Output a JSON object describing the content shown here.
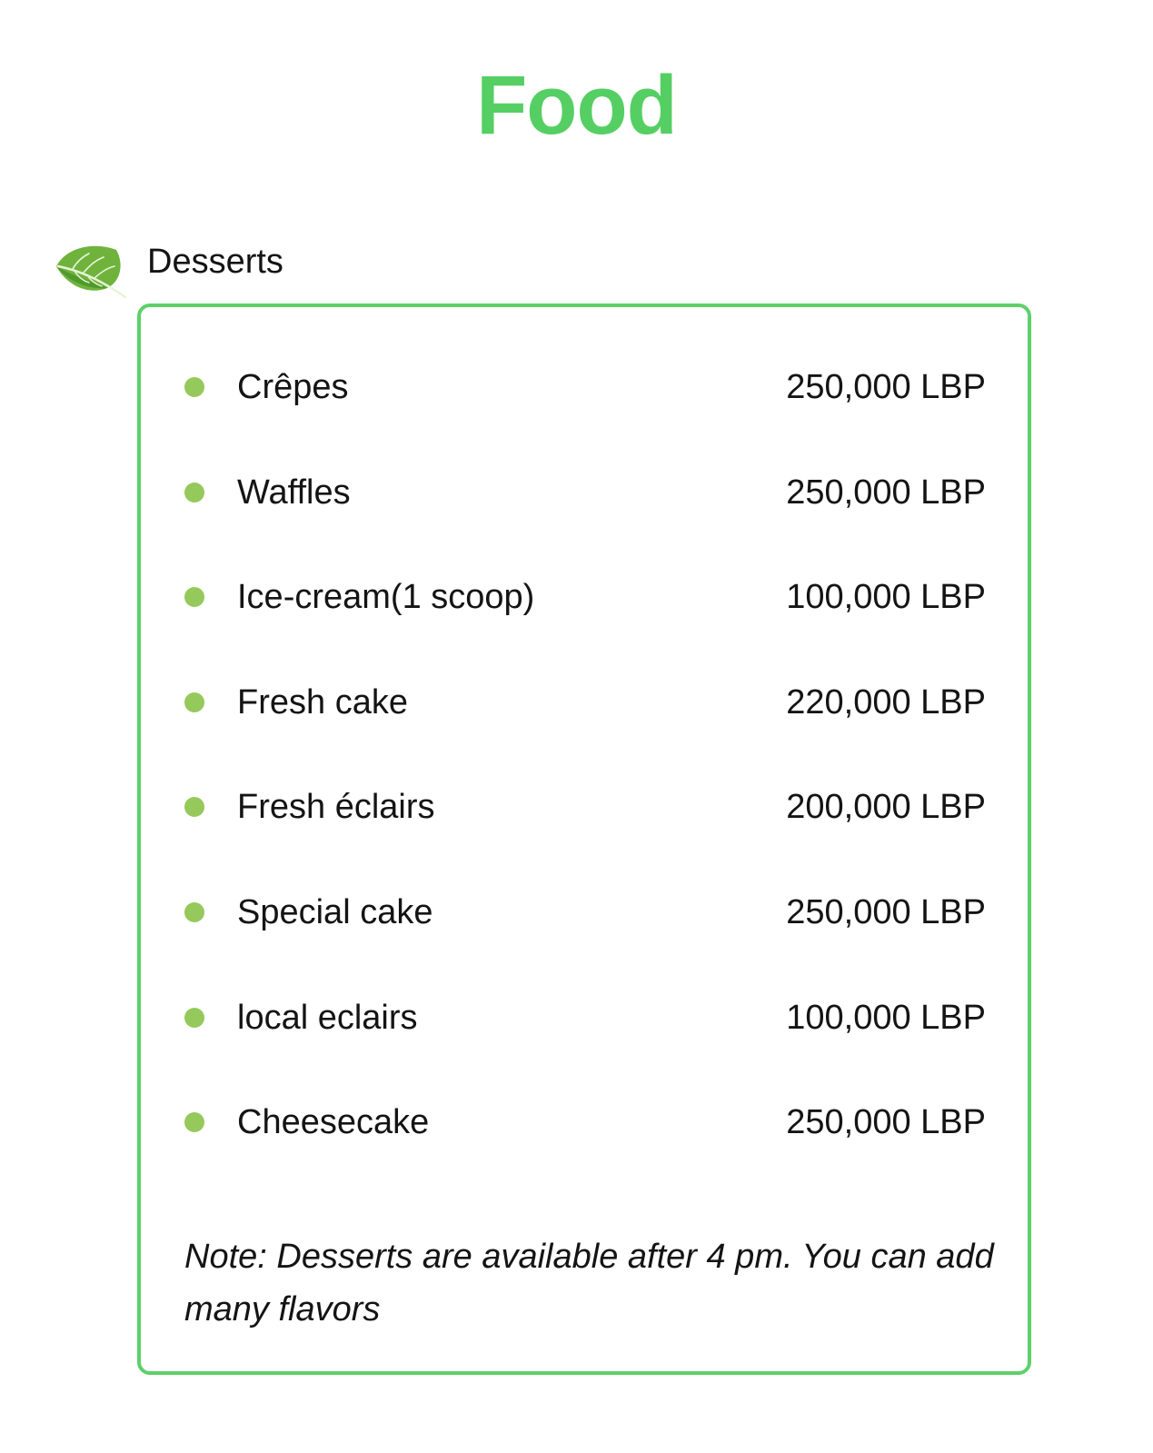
{
  "header": {
    "title": "Food",
    "title_color": "#55cf63"
  },
  "section": {
    "icon": "leaf-icon",
    "label": "Desserts",
    "border_color": "#5ed06a",
    "bullet_color": "#95c95b"
  },
  "items": [
    {
      "name": "Crêpes",
      "price": "250,000 LBP"
    },
    {
      "name": "Waffles",
      "price": "250,000 LBP"
    },
    {
      "name": "Ice-cream(1 scoop)",
      "price": "100,000 LBP"
    },
    {
      "name": "Fresh cake",
      "price": "220,000 LBP"
    },
    {
      "name": "Fresh éclairs",
      "price": "200,000 LBP"
    },
    {
      "name": "Special cake",
      "price": "250,000 LBP"
    },
    {
      "name": "local eclairs",
      "price": "100,000 LBP"
    },
    {
      "name": "Cheesecake",
      "price": "250,000 LBP"
    }
  ],
  "note": "Note: Desserts are available after 4 pm. You can add many flavors"
}
